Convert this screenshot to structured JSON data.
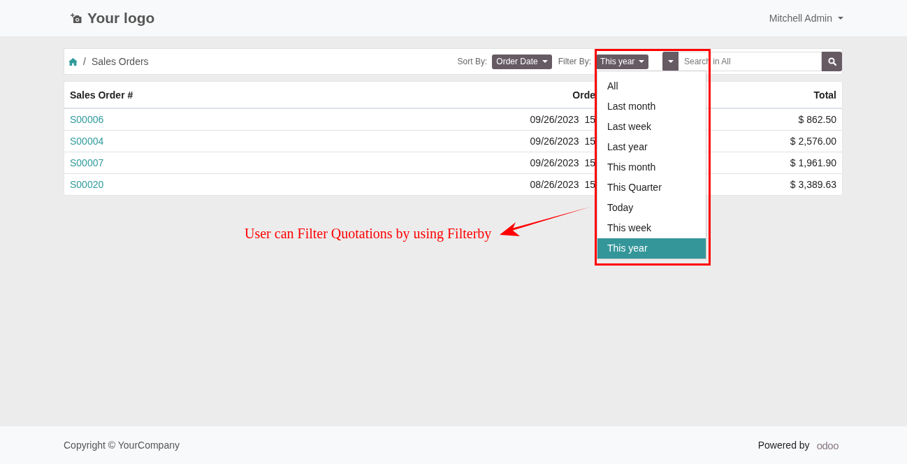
{
  "header": {
    "logo": "Your logo",
    "user": "Mitchell Admin"
  },
  "breadcrumb": {
    "separator": "/",
    "current": "Sales Orders"
  },
  "sort": {
    "label": "Sort By:",
    "value": "Order Date"
  },
  "filter": {
    "label": "Filter By:",
    "value": "This year",
    "expanded": true,
    "options": [
      {
        "label": "All",
        "selected": false
      },
      {
        "label": "Last month",
        "selected": false
      },
      {
        "label": "Last week",
        "selected": false
      },
      {
        "label": "Last year",
        "selected": false
      },
      {
        "label": "This month",
        "selected": false
      },
      {
        "label": "This Quarter",
        "selected": false
      },
      {
        "label": "Today",
        "selected": false
      },
      {
        "label": "This week",
        "selected": false
      },
      {
        "label": "This year",
        "selected": true
      }
    ]
  },
  "search": {
    "placeholder": "Search in All"
  },
  "table": {
    "columns": [
      "Sales Order #",
      "Orde",
      "Total"
    ],
    "rows": [
      {
        "order": "S00006",
        "date": "09/26/2023  15",
        "total": "$ 862.50"
      },
      {
        "order": "S00004",
        "date": "09/26/2023  15",
        "total": "$ 2,576.00"
      },
      {
        "order": "S00007",
        "date": "09/26/2023  15",
        "total": "$ 1,961.90"
      },
      {
        "order": "S00020",
        "date": "08/26/2023  15",
        "total": "$ 3,389.63"
      }
    ]
  },
  "annotation": {
    "text": "User can Filter Quotations by using Filterby"
  },
  "footer": {
    "copyright": "Copyright © YourCompany",
    "powered_by": "Powered by",
    "brand": "odoo"
  }
}
